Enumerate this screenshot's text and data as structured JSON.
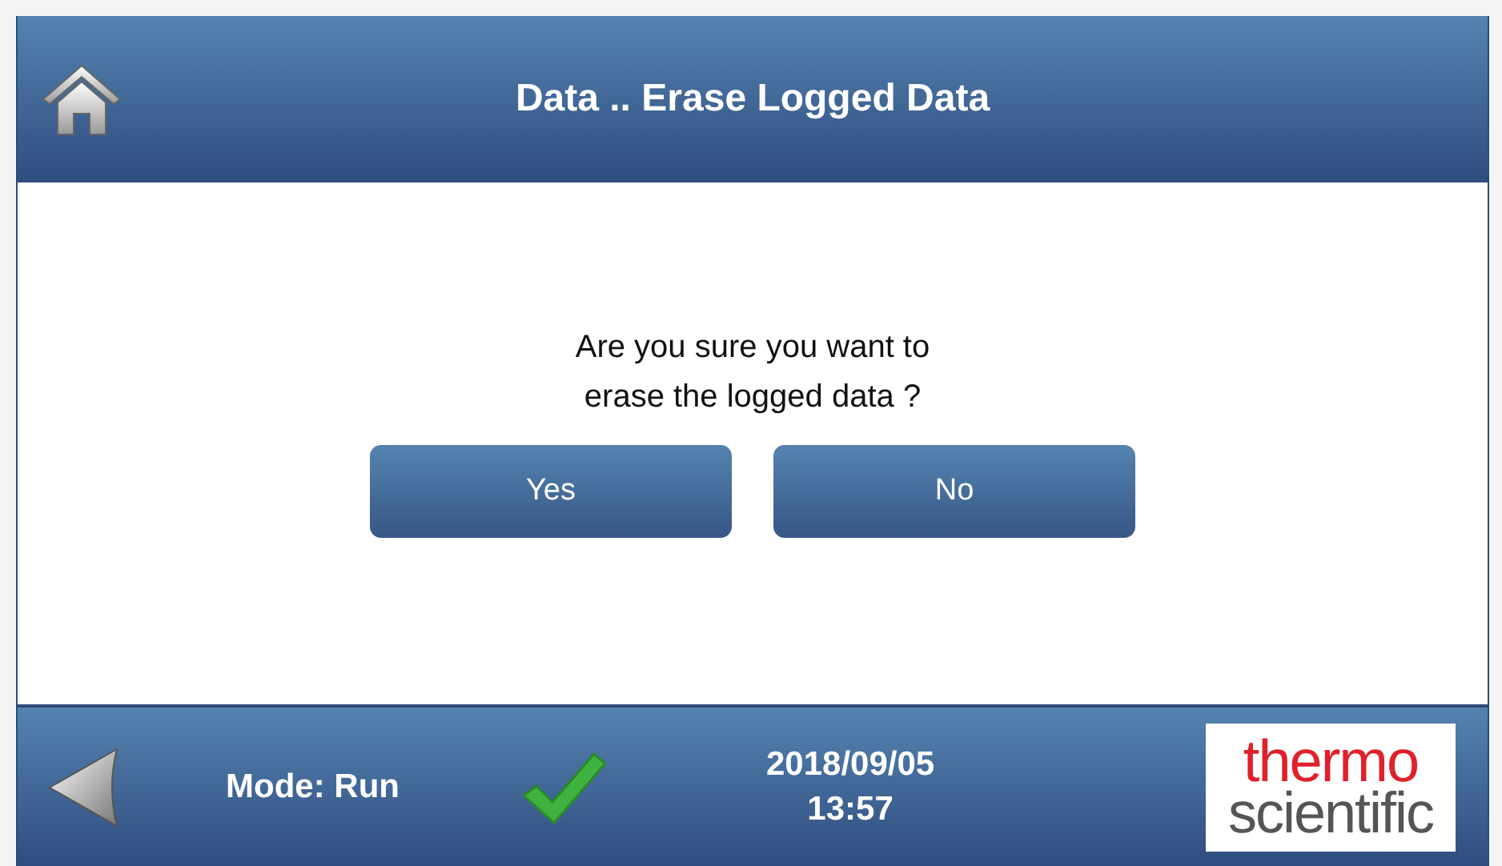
{
  "header": {
    "title": "Data .. Erase Logged Data"
  },
  "dialog": {
    "message_lines": [
      "Are you sure you want to",
      "erase the logged data ?"
    ],
    "buttons": [
      "Yes",
      "No"
    ]
  },
  "footer": {
    "mode": "Mode: Run",
    "date": "2018/09/05",
    "time": "13:57",
    "logo": {
      "top": "thermo",
      "bottom": "scientific"
    }
  }
}
